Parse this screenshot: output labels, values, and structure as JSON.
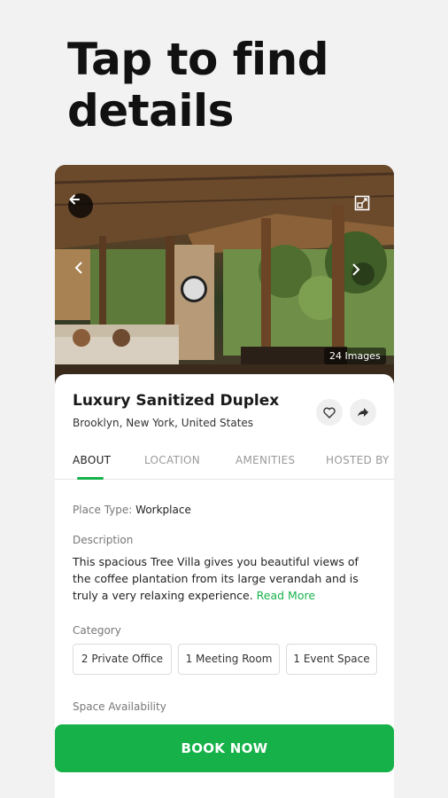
{
  "headline": {
    "line1": "Tap to find",
    "line2": "details"
  },
  "photo": {
    "images_count": "24 Images"
  },
  "listing": {
    "title": "Luxury Sanitized Duplex",
    "location": "Brooklyn, New York, United States"
  },
  "tabs": [
    {
      "label": "ABOUT"
    },
    {
      "label": "LOCATION"
    },
    {
      "label": "AMENITIES"
    },
    {
      "label": "HOSTED BY"
    }
  ],
  "about": {
    "place_type_label": "Place Type:",
    "place_type_value": "Workplace",
    "description_label": "Description",
    "description_text": "This spacious Tree Villa gives you beautiful views of the coffee plantation from its large verandah and is truly a very relaxing experience.",
    "read_more": "Read More",
    "category_label": "Category",
    "categories": [
      "2 Private Office",
      "1 Meeting Room",
      "1 Event Space"
    ],
    "space_availability_label": "Space Availability"
  },
  "cta": {
    "label": "BOOK NOW"
  },
  "colors": {
    "accent": "#17b14a",
    "background": "#f2f2f2"
  },
  "icons": [
    "back-arrow-icon",
    "expand-icon",
    "chevron-left-icon",
    "chevron-right-icon",
    "heart-icon",
    "share-icon"
  ]
}
